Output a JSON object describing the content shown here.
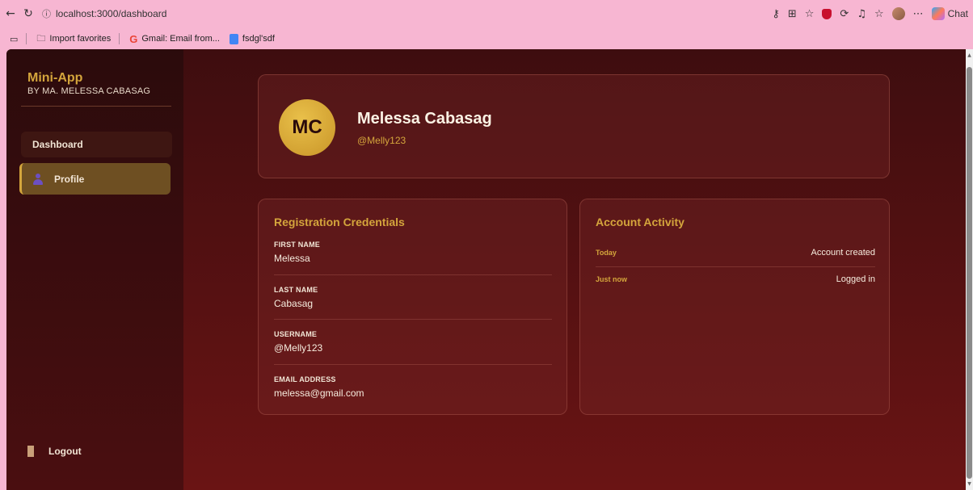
{
  "browser": {
    "url": "localhost:3000/dashboard",
    "bookmarks": [
      "Import favorites",
      "Gmail: Email from...",
      "fsdgl'sdf"
    ],
    "chat_label": "Chat"
  },
  "sidebar": {
    "brand_title": "Mini-App",
    "brand_subtitle": "BY MA. MELESSA CABASAG",
    "items": [
      {
        "label": "Dashboard"
      },
      {
        "label": "Profile"
      }
    ],
    "logout_label": "Logout"
  },
  "profile": {
    "initials": "MC",
    "name": "Melessa Cabasag",
    "handle": "@Melly123"
  },
  "credentials": {
    "title": "Registration Credentials",
    "fields": [
      {
        "label": "FIRST NAME",
        "value": "Melessa"
      },
      {
        "label": "LAST NAME",
        "value": "Cabasag"
      },
      {
        "label": "USERNAME",
        "value": "@Melly123"
      },
      {
        "label": "EMAIL ADDRESS",
        "value": "melessa@gmail.com"
      }
    ]
  },
  "activity": {
    "title": "Account Activity",
    "rows": [
      {
        "when": "Today",
        "what": "Account created"
      },
      {
        "when": "Just now",
        "what": "Logged in"
      }
    ]
  },
  "colors": {
    "accent_gold": "#d4a53c",
    "background_maroon": "#4a0e10"
  }
}
